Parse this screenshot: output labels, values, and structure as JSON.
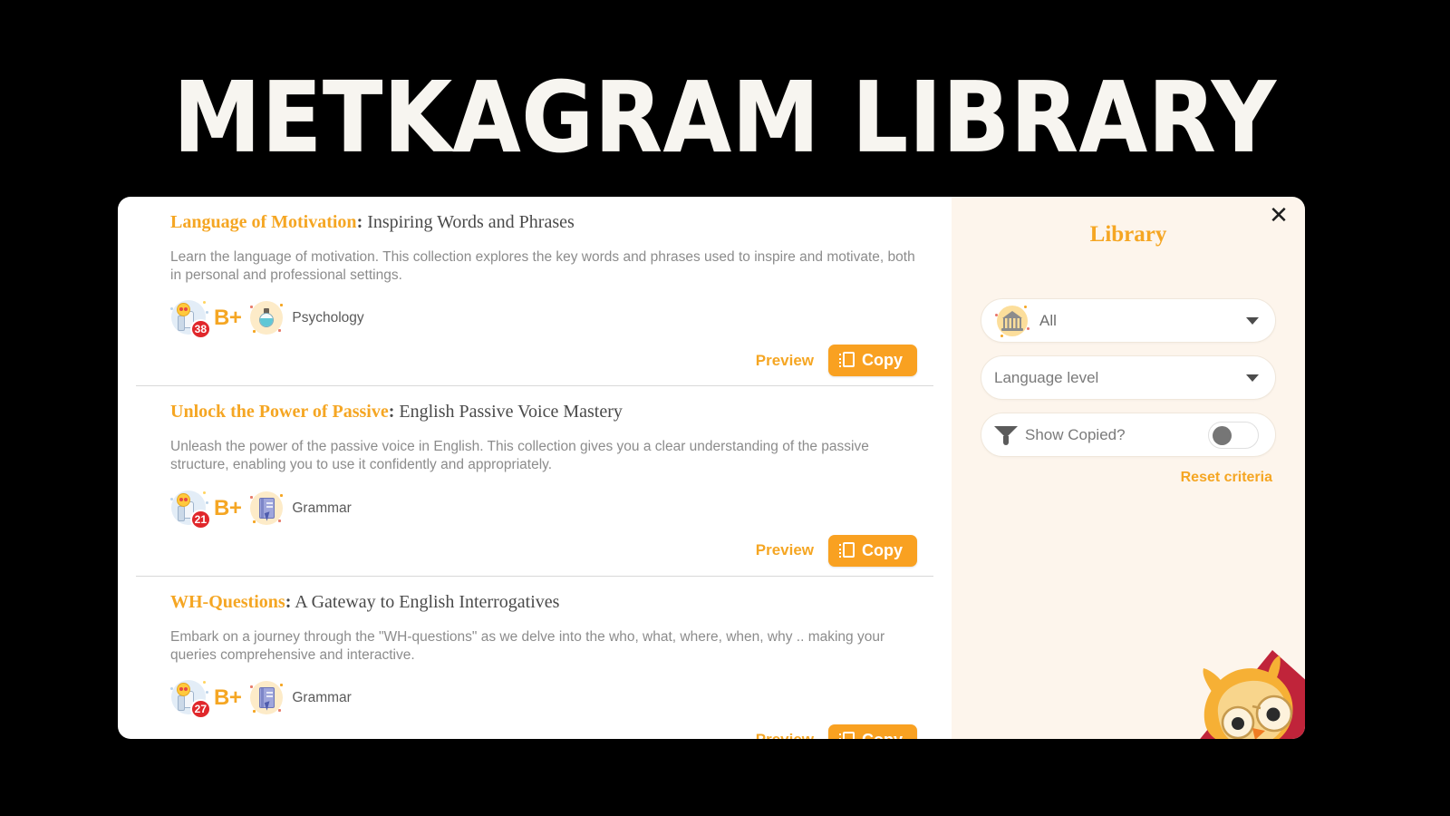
{
  "page": {
    "title": "METKAGRAM LIBRARY",
    "background_color": "#000000",
    "accent_color": "#F5A623"
  },
  "modal": {
    "close_icon": "close-icon"
  },
  "collections": [
    {
      "name": "Language of Motivation",
      "separator": ":",
      "subtitle": " Inspiring Words and Phrases",
      "description": "Learn the language of motivation. This collection explores the key words and phrases used to inspire and motivate, both in personal and professional settings.",
      "likes": "38",
      "likes_icon": "thumbs-up-icon",
      "grade": "B+",
      "topic": "Psychology",
      "topic_icon": "flask-icon",
      "preview_label": "Preview",
      "copy_label": "Copy",
      "copy_icon": "copy-icon"
    },
    {
      "name": "Unlock the Power of Passive",
      "separator": ":",
      "subtitle": " English Passive Voice Mastery",
      "description": "Unleash the power of the passive voice in English. This collection gives you a clear understanding of the passive structure, enabling you to use it confidently and appropriately.",
      "likes": "21",
      "likes_icon": "thumbs-up-icon",
      "grade": "B+",
      "topic": "Grammar",
      "topic_icon": "book-icon",
      "preview_label": "Preview",
      "copy_label": "Copy",
      "copy_icon": "copy-icon"
    },
    {
      "name": "WH-Questions",
      "separator": ":",
      "subtitle": " A Gateway to English Interrogatives",
      "description": "Embark on a journey through the \"WH-questions\" as we delve into the who, what, where, when, why .. making your queries comprehensive and interactive.",
      "likes": "27",
      "likes_icon": "thumbs-up-icon",
      "grade": "B+",
      "topic": "Grammar",
      "topic_icon": "book-icon",
      "preview_label": "Preview",
      "copy_label": "Copy",
      "copy_icon": "copy-icon"
    }
  ],
  "sidebar": {
    "title": "Library",
    "category_filter": {
      "value": "All",
      "icon": "bank-icon"
    },
    "level_filter": {
      "placeholder": "Language level",
      "value": "Language level"
    },
    "show_copied": {
      "label": "Show Copied?",
      "icon": "funnel-icon",
      "state": "off"
    },
    "reset_label": "Reset criteria",
    "mascot": "owl-mascot"
  }
}
